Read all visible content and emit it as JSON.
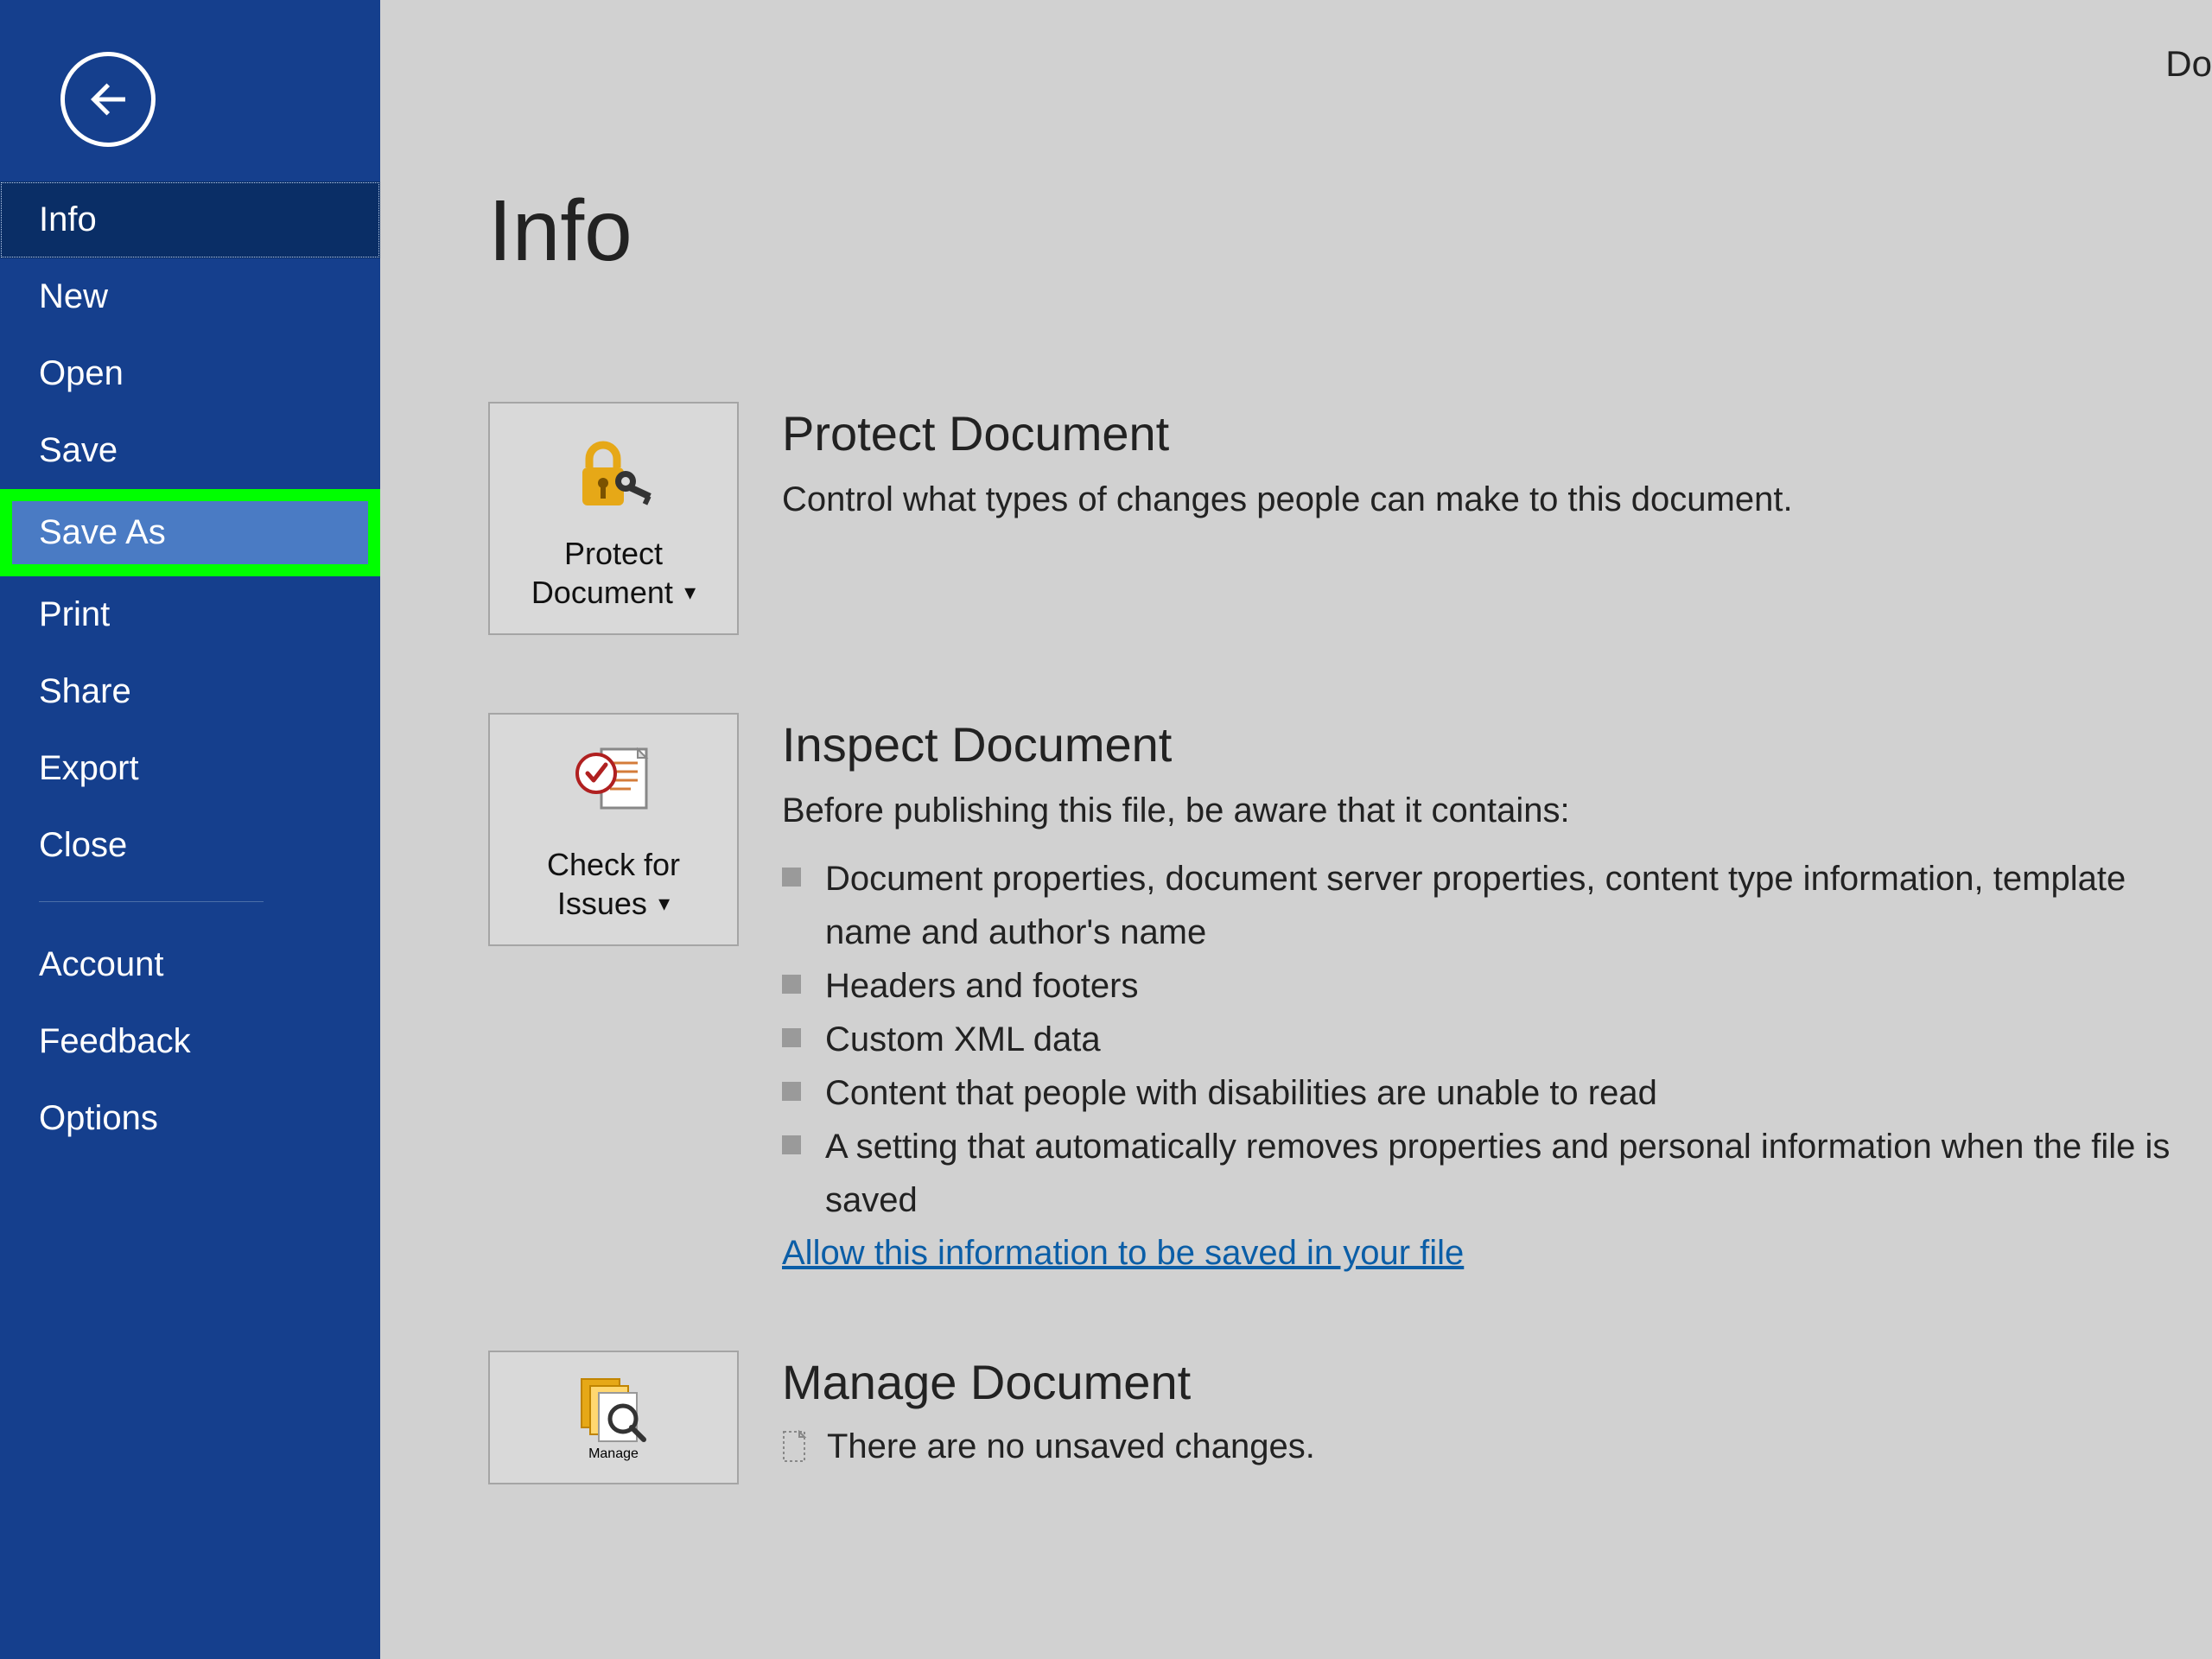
{
  "header": {
    "top_right": "Do"
  },
  "sidebar": {
    "items": [
      {
        "label": "Info",
        "state": "selected"
      },
      {
        "label": "New",
        "state": ""
      },
      {
        "label": "Open",
        "state": ""
      },
      {
        "label": "Save",
        "state": ""
      },
      {
        "label": "Save As",
        "state": "highlighted"
      },
      {
        "label": "Print",
        "state": ""
      },
      {
        "label": "Share",
        "state": ""
      },
      {
        "label": "Export",
        "state": ""
      },
      {
        "label": "Close",
        "state": ""
      }
    ],
    "footer_items": [
      {
        "label": "Account"
      },
      {
        "label": "Feedback"
      },
      {
        "label": "Options"
      }
    ]
  },
  "page": {
    "title": "Info"
  },
  "protect": {
    "card_label_line1": "Protect",
    "card_label_line2": "Document",
    "heading": "Protect Document",
    "desc": "Control what types of changes people can make to this document."
  },
  "inspect": {
    "card_label_line1": "Check for",
    "card_label_line2": "Issues",
    "heading": "Inspect Document",
    "desc": "Before publishing this file, be aware that it contains:",
    "bullets": [
      "Document properties, document server properties, content type information, template name and author's name",
      "Headers and footers",
      "Custom XML data",
      "Content that people with disabilities are unable to read",
      "A setting that automatically removes properties and personal information when the file is saved"
    ],
    "link": "Allow this information to be saved in your file"
  },
  "manage": {
    "card_label": "Manage",
    "heading": "Manage Document",
    "desc": "There are no unsaved changes."
  }
}
